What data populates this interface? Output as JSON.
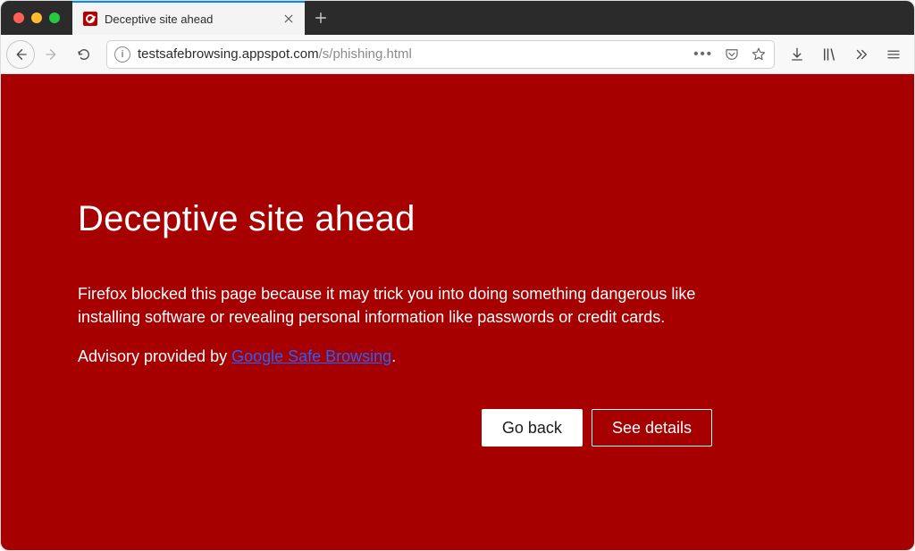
{
  "tab": {
    "title": "Deceptive site ahead"
  },
  "url": {
    "domain": "testsafebrowsing.appspot.com",
    "path": "/s/phishing.html"
  },
  "warning": {
    "heading": "Deceptive site ahead",
    "body": "Firefox blocked this page because it may trick you into doing something dangerous like installing software or revealing personal information like passwords or credit cards.",
    "advisory_prefix": "Advisory provided by ",
    "advisory_link": "Google Safe Browsing",
    "advisory_suffix": ".",
    "go_back": "Go back",
    "see_details": "See details"
  },
  "colors": {
    "warning_bg": "#a70000",
    "tab_active_accent": "#0a84ff",
    "link": "#2660ff"
  }
}
